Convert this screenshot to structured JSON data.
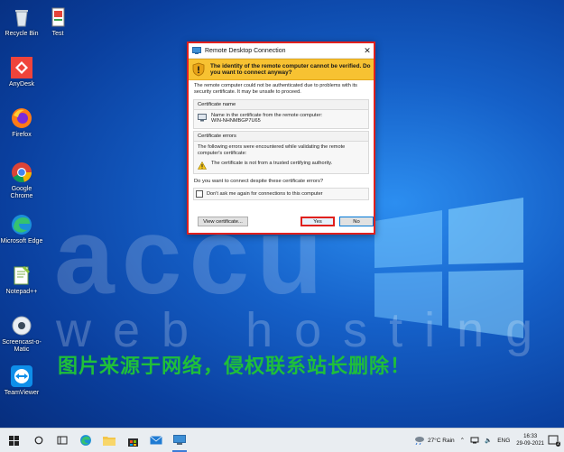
{
  "desktop": {
    "watermark_big": "accu",
    "watermark_small": "web hosting",
    "notice": "图片来源于网络，侵权联系站长删除！",
    "icons": [
      {
        "name": "recycle-bin",
        "label": "Recycle Bin"
      },
      {
        "name": "test",
        "label": "Test"
      },
      {
        "name": "anydesk",
        "label": "AnyDesk"
      },
      {
        "name": "firefox",
        "label": "Firefox"
      },
      {
        "name": "chrome",
        "label": "Google Chrome"
      },
      {
        "name": "edge",
        "label": "Microsoft Edge"
      },
      {
        "name": "notepad",
        "label": "Notepad++"
      },
      {
        "name": "screencast",
        "label": "Screencast-o-Matic"
      },
      {
        "name": "teamviewer",
        "label": "TeamViewer"
      }
    ]
  },
  "dialog": {
    "title": "Remote Desktop Connection",
    "close_glyph": "✕",
    "warning": "The identity of the remote computer cannot be verified. Do you want to connect anyway?",
    "description": "The remote computer could not be authenticated due to problems with its security certificate. It may be unsafe to proceed.",
    "cert_name_title": "Certificate name",
    "cert_name_label": "Name in the certificate from the remote computer:",
    "cert_name_value": "WIN-NHNMBGP7U65",
    "cert_errors_title": "Certificate errors",
    "cert_errors_intro": "The following errors were encountered while validating the remote computer's certificate:",
    "cert_error_1": "The certificate is not from a trusted certifying authority.",
    "question": "Do you want to connect despite these certificate errors?",
    "dont_ask": "Don't ask me again for connections to this computer",
    "view_cert_label": "View certificate...",
    "yes_label": "Yes",
    "no_label": "No"
  },
  "taskbar": {
    "weather": "27°C  Rain",
    "language": "ENG",
    "time": "16:33",
    "date": "29-09-2021",
    "notification_count": "2"
  },
  "colors": {
    "highlight": "#e0201d",
    "warning_bar": "#f7c232",
    "accent": "#0078d7"
  }
}
